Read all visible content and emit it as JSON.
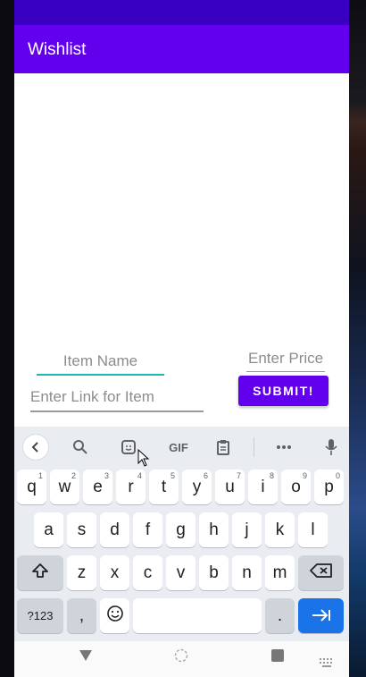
{
  "app": {
    "title": "Wishlist"
  },
  "form": {
    "item_name_hint": "Item Name",
    "price_hint": "Enter Price",
    "link_hint": "Enter Link for Item",
    "submit_label": "SUBMIT!"
  },
  "keyboard": {
    "toolbar": {
      "gif_label": "GIF",
      "icons": [
        "back-icon",
        "search-icon",
        "sticker-icon",
        "gif-icon",
        "clipboard-icon",
        "more-icon",
        "mic-icon"
      ]
    },
    "row1": [
      {
        "k": "q",
        "h": "1"
      },
      {
        "k": "w",
        "h": "2"
      },
      {
        "k": "e",
        "h": "3"
      },
      {
        "k": "r",
        "h": "4"
      },
      {
        "k": "t",
        "h": "5"
      },
      {
        "k": "y",
        "h": "6"
      },
      {
        "k": "u",
        "h": "7"
      },
      {
        "k": "i",
        "h": "8"
      },
      {
        "k": "o",
        "h": "9"
      },
      {
        "k": "p",
        "h": "0"
      }
    ],
    "row2": [
      "a",
      "s",
      "d",
      "f",
      "g",
      "h",
      "j",
      "k",
      "l"
    ],
    "row3": [
      "z",
      "x",
      "c",
      "v",
      "b",
      "n",
      "m"
    ],
    "symbols_label": "?123",
    "comma_label": ",",
    "period_label": "."
  },
  "colors": {
    "primary": "#6200ee",
    "status_bar": "#3a00c2",
    "accent": "#1bb9b3",
    "enter_key": "#1a73e8"
  }
}
